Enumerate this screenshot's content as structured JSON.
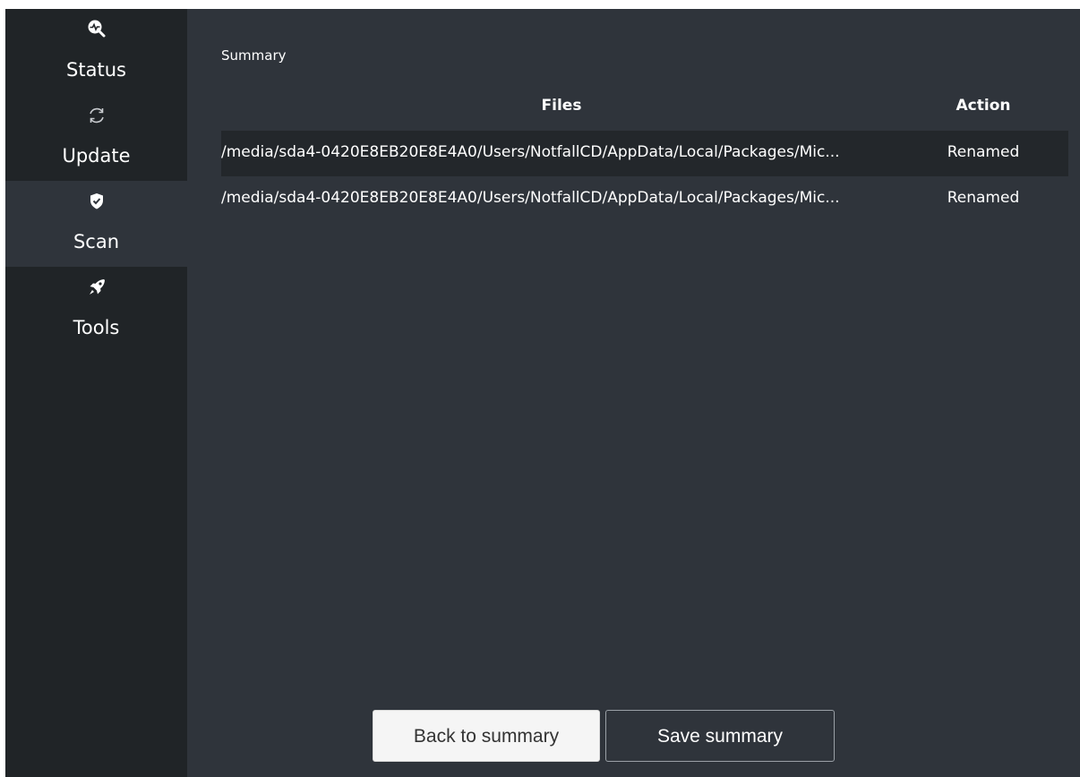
{
  "sidebar": {
    "items": [
      {
        "label": "Status",
        "icon": "status-search-icon",
        "active": false
      },
      {
        "label": "Update",
        "icon": "update-sync-icon",
        "active": false
      },
      {
        "label": "Scan",
        "icon": "shield-check-icon",
        "active": true
      },
      {
        "label": "Tools",
        "icon": "rocket-icon",
        "active": false
      }
    ]
  },
  "main": {
    "title": "Summary",
    "table": {
      "columns": [
        "Files",
        "Action"
      ],
      "rows": [
        {
          "file": "/media/sda4-0420E8EB20E8E4A0/Users/NotfallCD/AppData/Local/Packages/Mic...",
          "action": "Renamed"
        },
        {
          "file": "/media/sda4-0420E8EB20E8E4A0/Users/NotfallCD/AppData/Local/Packages/Mic...",
          "action": "Renamed"
        }
      ]
    },
    "buttons": {
      "back_label": "Back to summary",
      "save_label": "Save summary"
    }
  },
  "colors": {
    "sidebar_bg": "#202427",
    "content_bg": "#2f343b",
    "row_highlight": "#23272b",
    "text": "#ffffff"
  }
}
